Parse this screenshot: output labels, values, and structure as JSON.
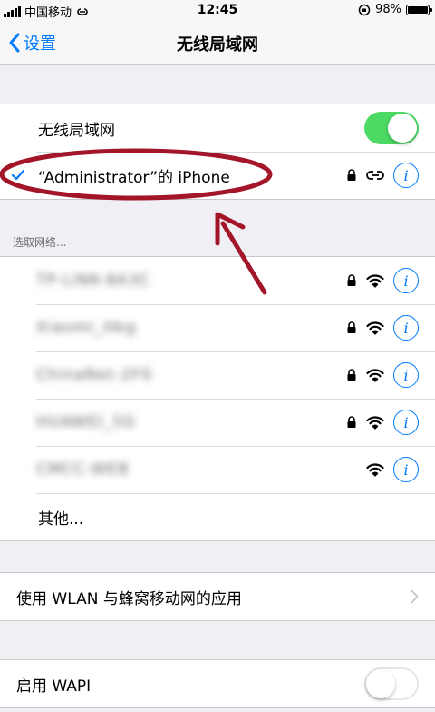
{
  "status_bar": {
    "carrier": "中国移动",
    "time": "12:45",
    "battery": "98%"
  },
  "nav": {
    "back_label": "设置",
    "title": "无线局域网"
  },
  "wlan": {
    "toggle_label": "无线局域网",
    "toggle_state": "on",
    "connected_network": "“Administrator”的 iPhone"
  },
  "choose_network": {
    "header": "选取网络...",
    "networks": [
      {
        "name": "TP-LINK-8A3C",
        "locked": true
      },
      {
        "name": "Xiaomi_Hkg",
        "locked": true
      },
      {
        "name": "ChinaNet-2F0",
        "locked": true
      },
      {
        "name": "HUAWEI_5G",
        "locked": true
      },
      {
        "name": "CMCC-WEB",
        "locked": false
      }
    ],
    "other_label": "其他..."
  },
  "apps_using_wlan": {
    "label": "使用 WLAN 与蜂窝移动网的应用"
  },
  "wapi": {
    "label": "启用 WAPI",
    "toggle_state": "off"
  },
  "colors": {
    "accent": "#007aff",
    "toggle_on": "#4cd964",
    "annotation": "#a3162a"
  }
}
